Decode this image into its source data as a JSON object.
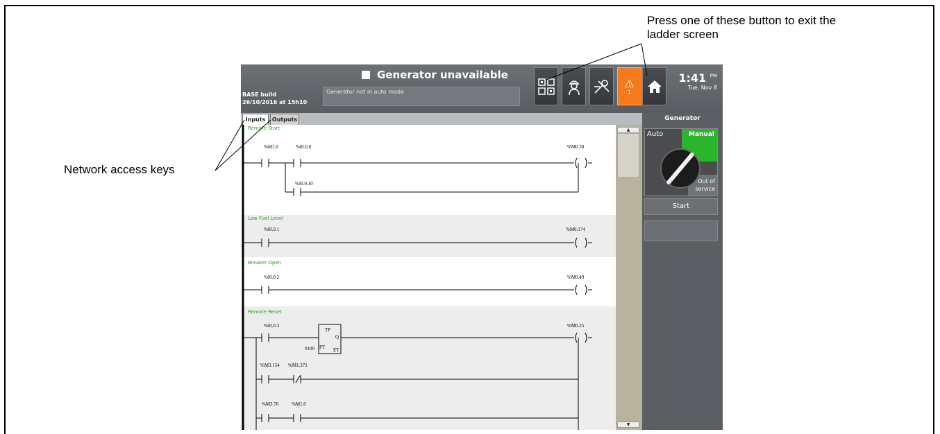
{
  "callouts": {
    "exit_note_line1": "Press one of these button to exit the",
    "exit_note_line2": "ladder screen",
    "network_keys": "Network access keys"
  },
  "header": {
    "build_line1": "BASE build",
    "build_line2": "26/10/2016 at 15h10",
    "status_title": "Generator unavailable",
    "status_message": "Generator not in auto mode",
    "alarm_count": "1",
    "time": "1:41",
    "time_suffix": "PM",
    "date": "Tue, Nov 8"
  },
  "toolbar_icons": [
    "ladder-icon",
    "operator-icon",
    "tools-icon",
    "alarm-icon",
    "home-icon"
  ],
  "tabs": [
    {
      "label": "Inputs",
      "active": true
    },
    {
      "label": "Outputs",
      "active": false
    }
  ],
  "rungs": [
    {
      "title": "Remote Start",
      "contacts": [
        "%M1.0",
        "%I0.0.0"
      ],
      "branch": [
        "%I0.0.10"
      ],
      "coil": "%M0.38"
    },
    {
      "title": "Low Fuel Level",
      "contacts": [
        "%I0.0.1"
      ],
      "coil": "%M0.174"
    },
    {
      "title": "Breaker Open",
      "contacts": [
        "%I0.0.2"
      ],
      "coil": "%M0.49"
    },
    {
      "title": "Remote Reset",
      "contacts": [
        "%I0.0.3"
      ],
      "timer": {
        "type": "TP",
        "pt": "#100",
        "pt_label": "PT",
        "q": "Q",
        "et": "ET"
      },
      "branch1": [
        "%M3.154",
        "%M1.371"
      ],
      "branch2": [
        "%M3.76",
        "%M1.0"
      ],
      "coil": "%M0.25"
    }
  ],
  "side_panel": {
    "title": "Generator",
    "mode_auto": "Auto",
    "mode_manual": "Manual",
    "mode_out_line1": "Out of",
    "mode_out_line2": "service",
    "selected_mode": "Manual",
    "start_label": "Start"
  },
  "colors": {
    "accent_green": "#2ab52a",
    "alarm_orange": "#f57a1c",
    "rung_title_green": "#2a9a2a"
  }
}
